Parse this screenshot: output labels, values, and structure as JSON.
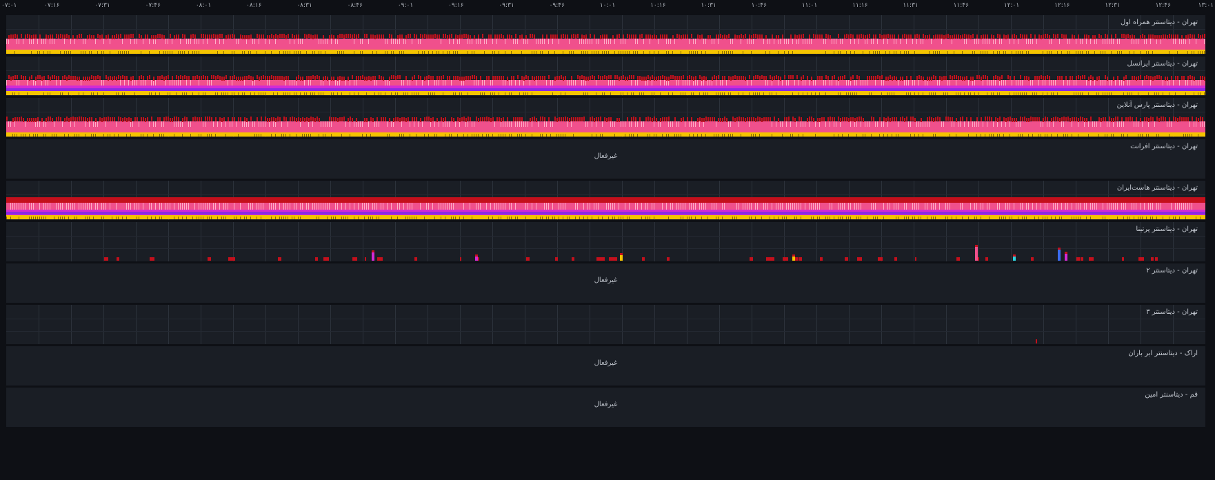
{
  "axis": {
    "ticks": [
      "۰۷:۰۱",
      "۰۷:۱۶",
      "۰۷:۳۱",
      "۰۷:۴۶",
      "۰۸:۰۱",
      "۰۸:۱۶",
      "۰۸:۳۱",
      "۰۸:۴۶",
      "۰۹:۰۱",
      "۰۹:۱۶",
      "۰۹:۳۱",
      "۰۹:۴۶",
      "۱۰:۰۱",
      "۱۰:۱۶",
      "۱۰:۳۱",
      "۱۰:۴۶",
      "۱۱:۰۱",
      "۱۱:۱۶",
      "۱۱:۳۱",
      "۱۱:۴۶",
      "۱۲:۰۱",
      "۱۲:۱۶",
      "۱۲:۳۱",
      "۱۲:۴۶",
      "۱۳:۰۱"
    ]
  },
  "inactive_label": "غیرفعال",
  "colors": {
    "red": "#c4101c",
    "pink": "#f0508c",
    "magenta": "#d42ad4",
    "purple": "#8a2be2",
    "yellow": "#f5c400",
    "cyan": "#2dd4e0",
    "blue": "#3b6cf0",
    "panel": "#1a1e25",
    "background": "#0e1015"
  },
  "panels": [
    {
      "title": "تهران - دیتاسنتر همراه اول",
      "status": "active",
      "pattern": "heavy"
    },
    {
      "title": "تهران - دیتاسنتر ایرانسل",
      "status": "active",
      "pattern": "heavy_magenta"
    },
    {
      "title": "تهران - دیتاسنتر پارس آنلاین",
      "status": "active",
      "pattern": "heavy"
    },
    {
      "title": "تهران - دیتاسنتر افرانت",
      "status": "inactive",
      "pattern": "none"
    },
    {
      "title": "تهران - دیتاسنتر هاست‌ایران",
      "status": "active",
      "pattern": "full"
    },
    {
      "title": "تهران - دیتاسنتر پرتینا",
      "status": "active",
      "pattern": "sparse"
    },
    {
      "title": "تهران - دیتاسنتر ۲",
      "status": "inactive",
      "pattern": "none"
    },
    {
      "title": "تهران - دیتاسنتر ۳",
      "status": "active",
      "pattern": "single"
    },
    {
      "title": "اراک - دیتاسنتر ابر باران",
      "status": "inactive",
      "pattern": "none"
    },
    {
      "title": "قم - دیتاسنتر امین",
      "status": "inactive",
      "pattern": "none"
    }
  ]
}
